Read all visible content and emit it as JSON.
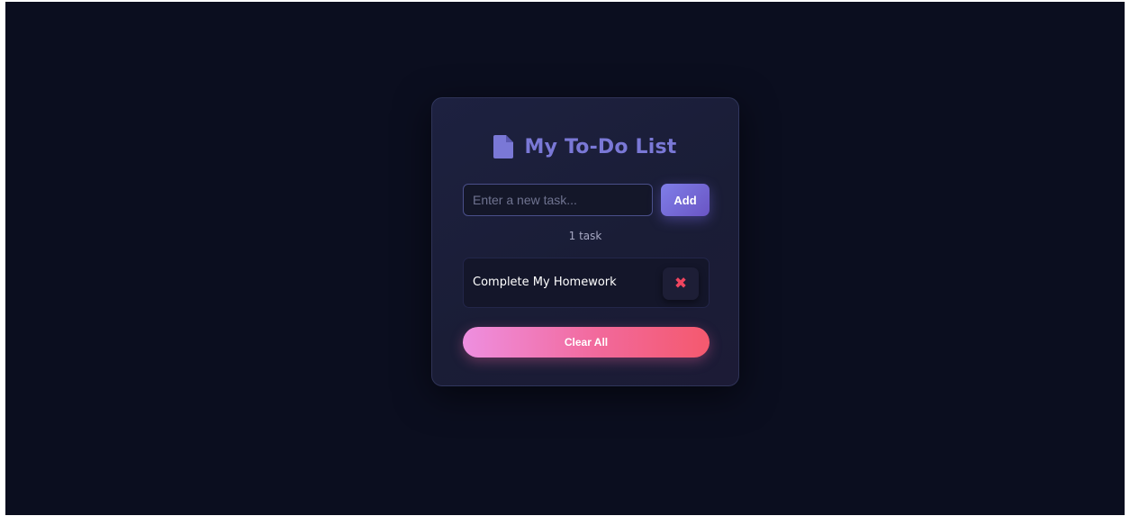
{
  "app": {
    "title": "My To-Do List",
    "title_icon": "document-icon"
  },
  "new_task": {
    "placeholder": "Enter a new task...",
    "value": "",
    "add_label": "Add"
  },
  "task_count_label": "1 task",
  "tasks": [
    {
      "label": "Complete My Homework",
      "delete_icon": "close-icon",
      "delete_glyph": "✖"
    }
  ],
  "clear_all_label": "Clear All",
  "colors": {
    "background": "#0b0e1f",
    "card": "#1c1f3a",
    "accent": "#7a78d6",
    "delete": "#f0455f",
    "clear_gradient_start": "#ee8fe0",
    "clear_gradient_end": "#f4596e"
  }
}
